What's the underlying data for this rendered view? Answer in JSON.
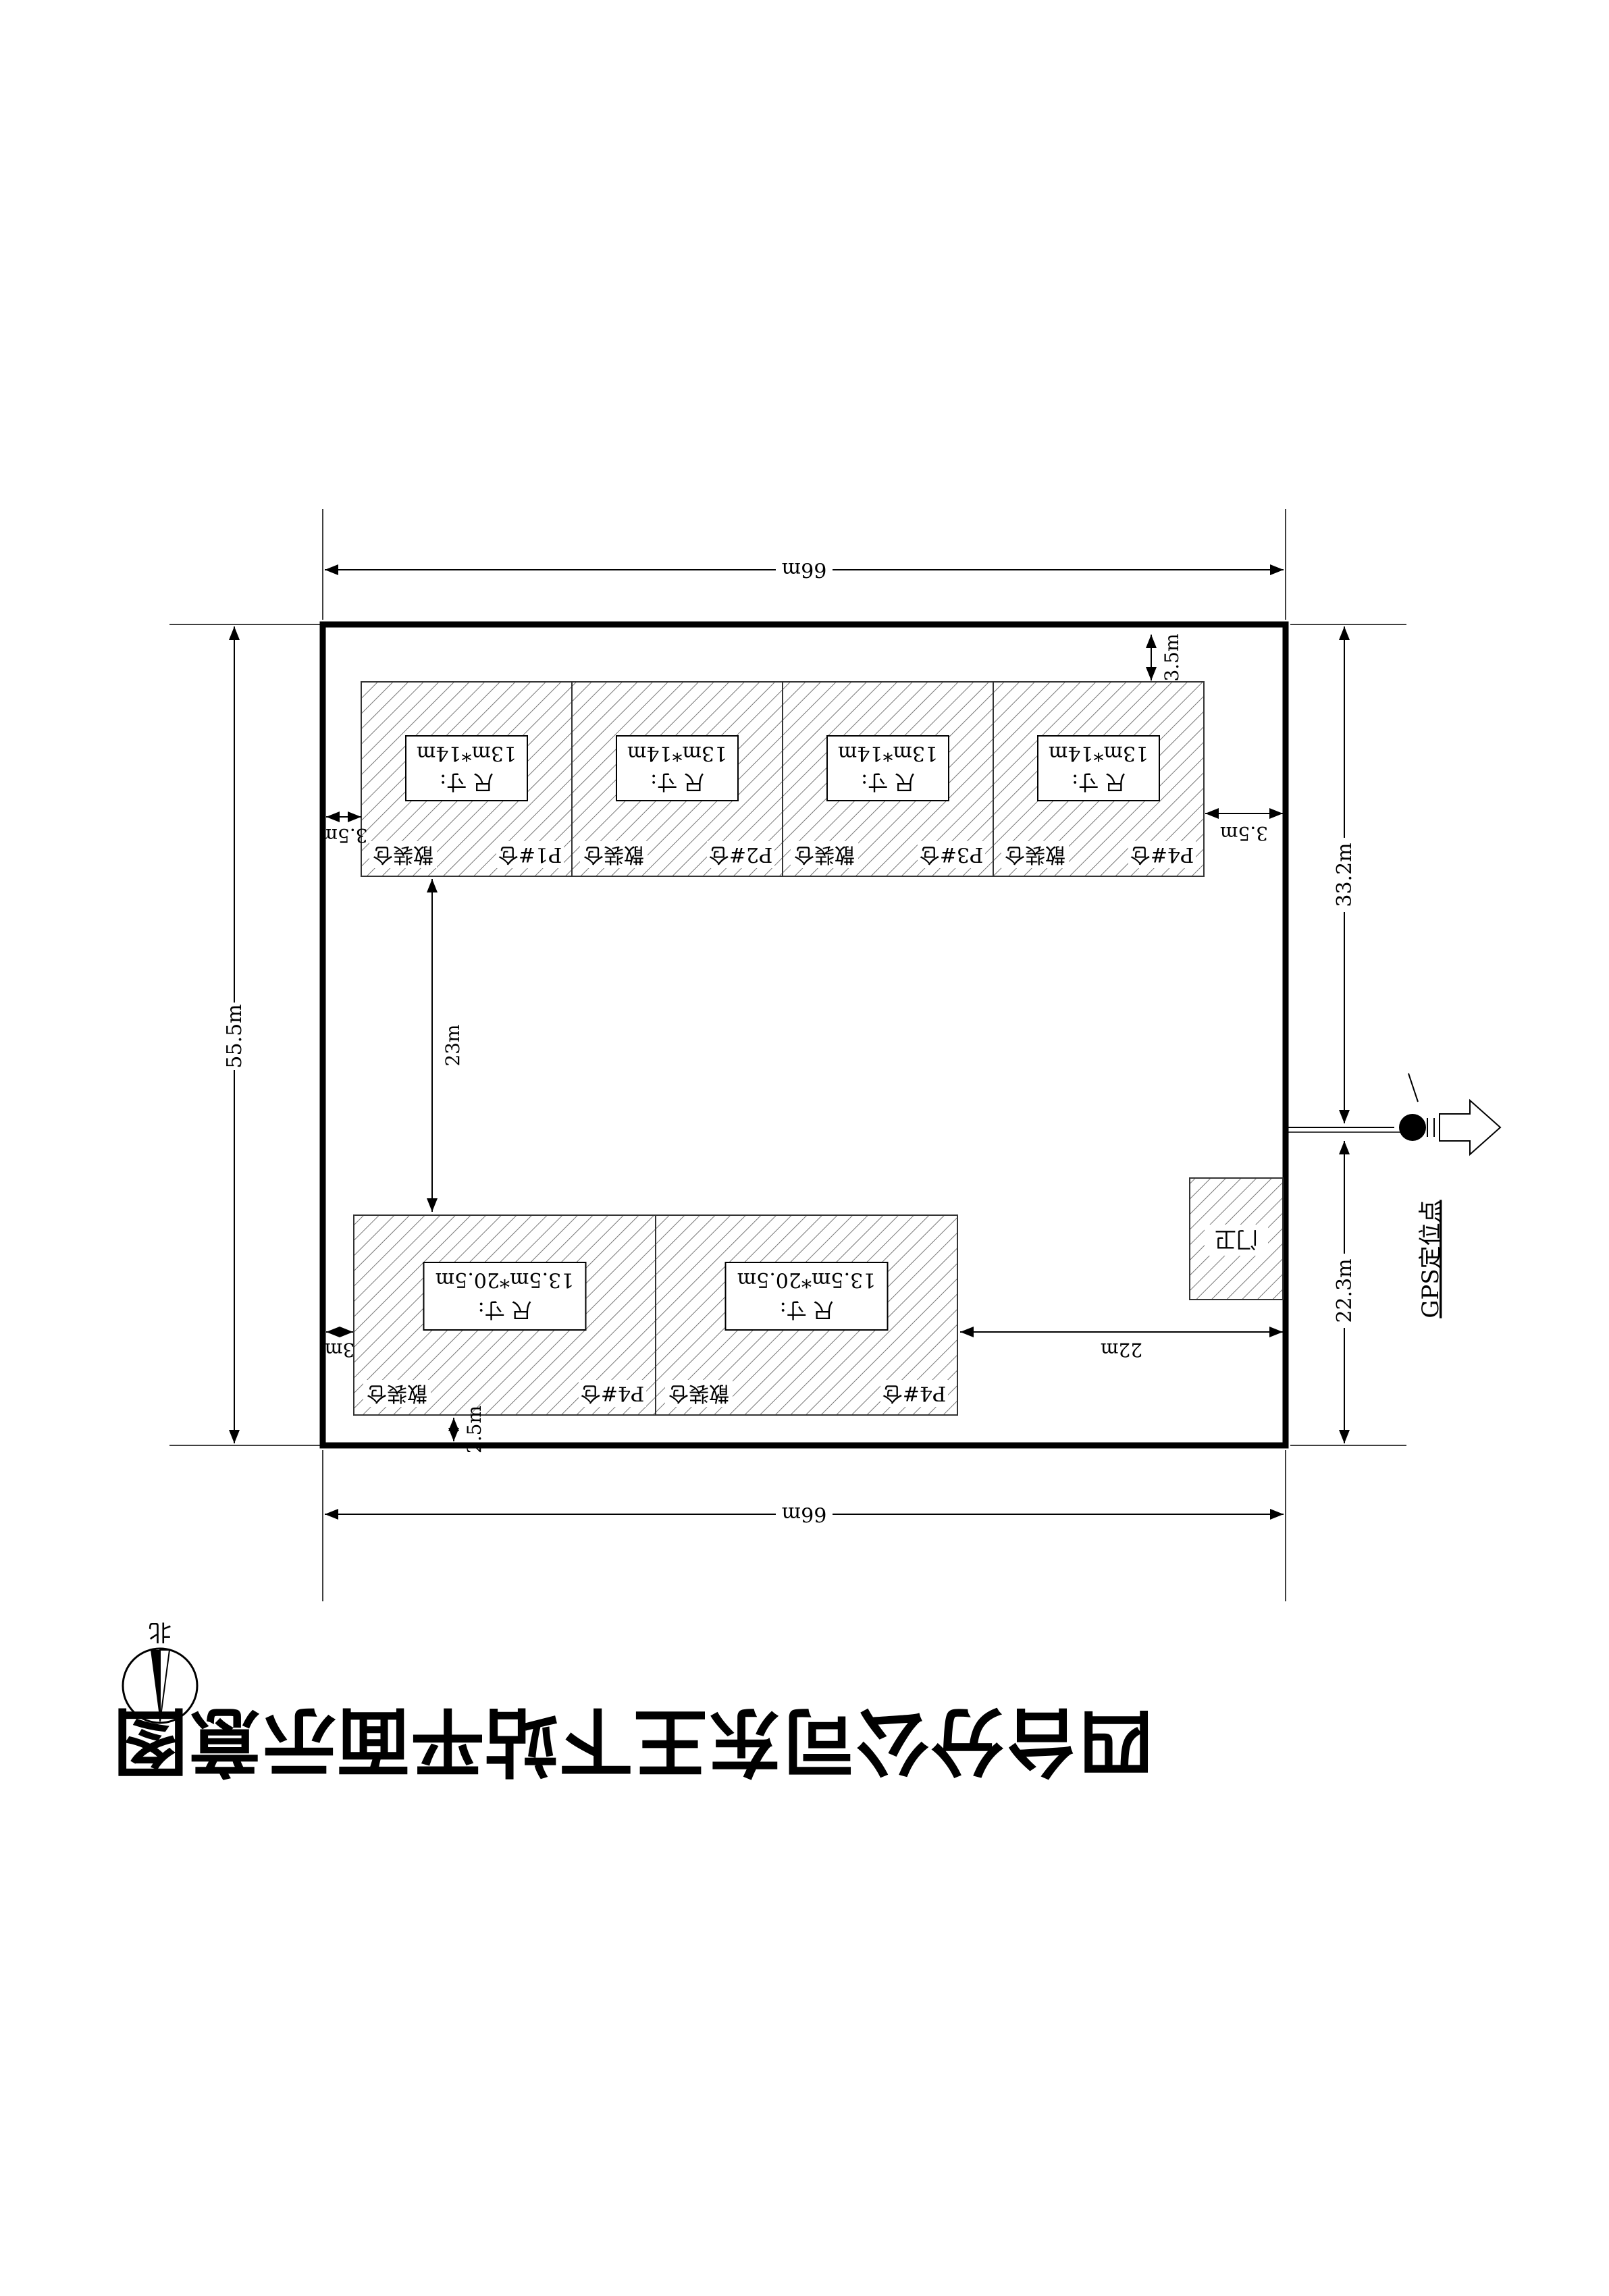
{
  "title": "四台分公司东王下站平面示意图",
  "north_label": "北",
  "gps": {
    "label": "GPS定位点"
  },
  "gate_label": "门卫",
  "dimensions": {
    "width_top": "66m",
    "width_bottom": "66m",
    "height_total": "55.5m",
    "right_upper": "33.2m",
    "right_lower": "22.3m",
    "top_gap": "3.5m",
    "top_left_gap": "3.5m",
    "top_right_gap": "3.5m",
    "aisle": "23m",
    "bottom_left_gap": "3m",
    "bottom_gap": "2.5m",
    "bottom_right_gap": "22m"
  },
  "warehouses_top": [
    {
      "name": "P1#仓",
      "type": "散装仓",
      "size_label": "尺  寸:",
      "size": "13m*14m"
    },
    {
      "name": "P2#仓",
      "type": "散装仓",
      "size_label": "尺  寸:",
      "size": "13m*14m"
    },
    {
      "name": "P3#仓",
      "type": "散装仓",
      "size_label": "尺  寸:",
      "size": "13m*14m"
    },
    {
      "name": "P4#仓",
      "type": "散装仓",
      "size_label": "尺  寸:",
      "size": "13m*14m"
    }
  ],
  "warehouses_bottom": [
    {
      "name": "P4#仓",
      "type": "散装仓",
      "size_label": "尺  寸:",
      "size": "13.5m*20.5m"
    },
    {
      "name": "P4#仓",
      "type": "散装仓",
      "size_label": "尺  寸:",
      "size": "13.5m*20.5m"
    }
  ]
}
